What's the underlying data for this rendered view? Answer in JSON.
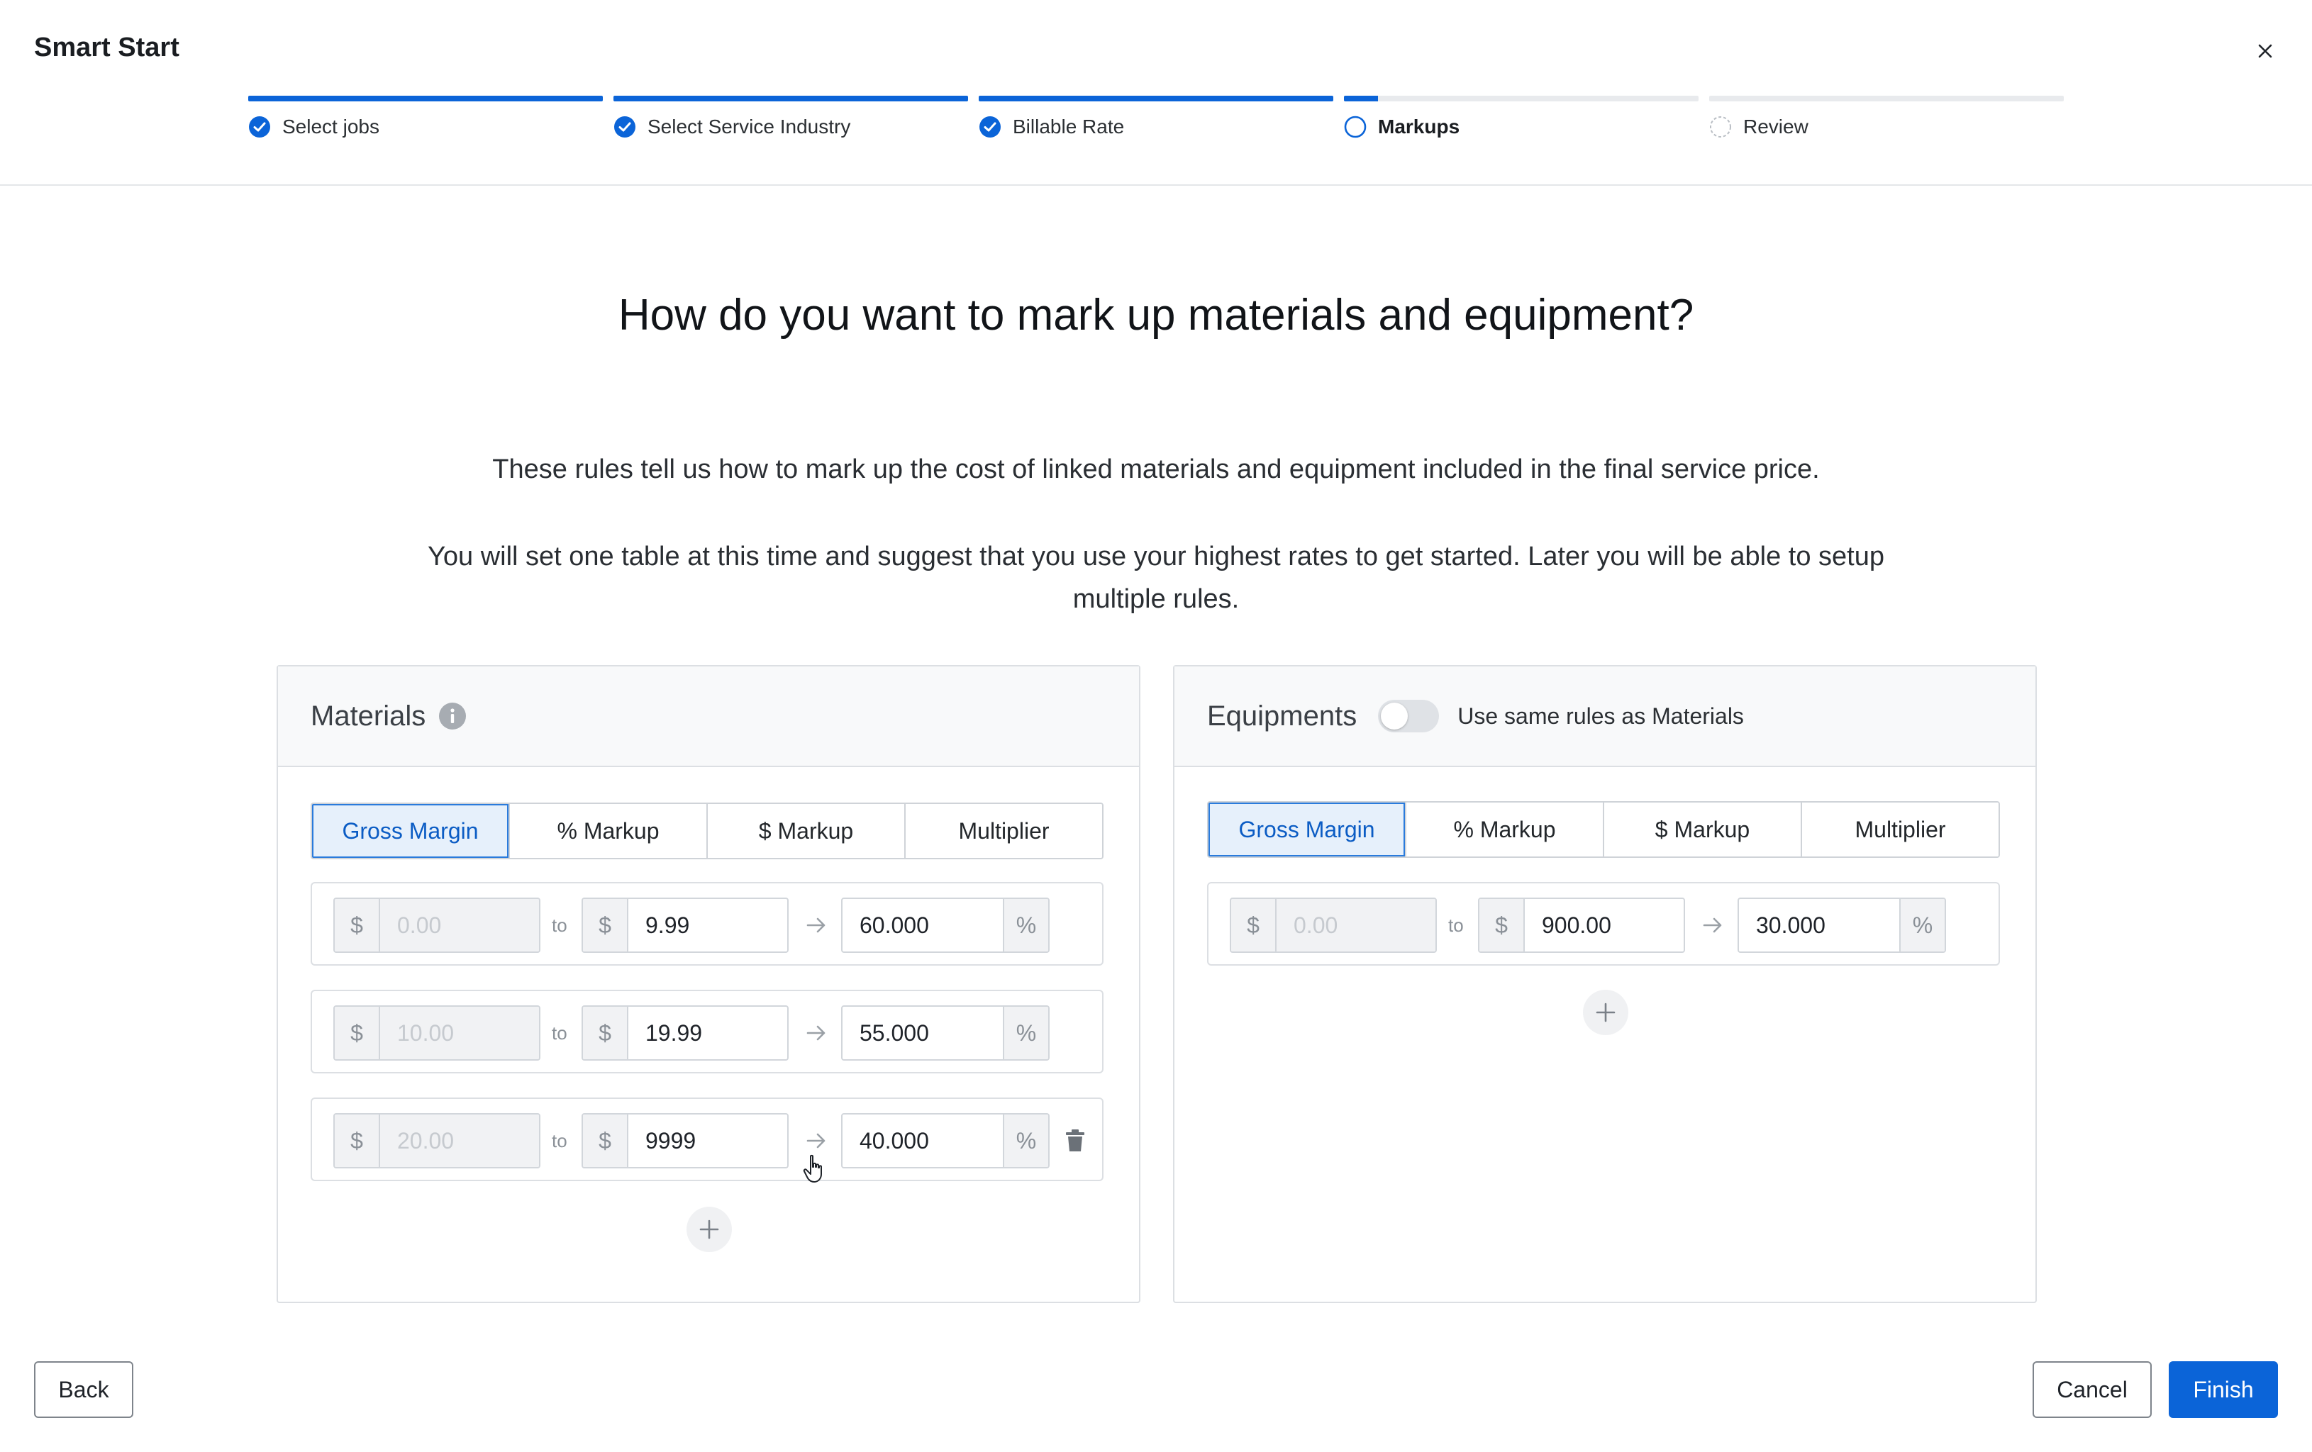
{
  "app": {
    "title": "Smart Start"
  },
  "steps": [
    {
      "label": "Select jobs",
      "status": "complete",
      "progress": 1.0
    },
    {
      "label": "Select Service Industry",
      "status": "complete",
      "progress": 1.0
    },
    {
      "label": "Billable Rate",
      "status": "complete",
      "progress": 1.0
    },
    {
      "label": "Markups",
      "status": "current",
      "progress": 0.1
    },
    {
      "label": "Review",
      "status": "pending",
      "progress": 0.0
    }
  ],
  "main": {
    "title": "How do you want to mark up materials and equipment?",
    "description1": "These rules tell us how to mark up the cost of linked materials and equipment included in the final service price.",
    "description2": "You will set one table at this time and suggest that you use your highest rates to get started. Later you will be able to setup multiple rules."
  },
  "materials": {
    "title": "Materials",
    "tabs": [
      "Gross Margin",
      "% Markup",
      "$ Markup",
      "Multiplier"
    ],
    "active_tab": "Gross Margin",
    "rows": [
      {
        "from": "0.00",
        "to": "9.99",
        "rate": "60.000"
      },
      {
        "from": "10.00",
        "to": "19.99",
        "rate": "55.000"
      },
      {
        "from": "20.00",
        "to": "9999",
        "rate": "40.000"
      }
    ]
  },
  "equipments": {
    "title": "Equipments",
    "toggle_label": "Use same rules as Materials",
    "toggle_on": false,
    "tabs": [
      "Gross Margin",
      "% Markup",
      "$ Markup",
      "Multiplier"
    ],
    "active_tab": "Gross Margin",
    "rows": [
      {
        "from": "0.00",
        "to": "900.00",
        "rate": "30.000"
      }
    ]
  },
  "symbols": {
    "currency": "$",
    "percent": "%",
    "to": "to"
  },
  "footer": {
    "back": "Back",
    "cancel": "Cancel",
    "finish": "Finish"
  },
  "colors": {
    "accent": "#0b64d8",
    "active_tab_bg": "#e6f0fb"
  }
}
